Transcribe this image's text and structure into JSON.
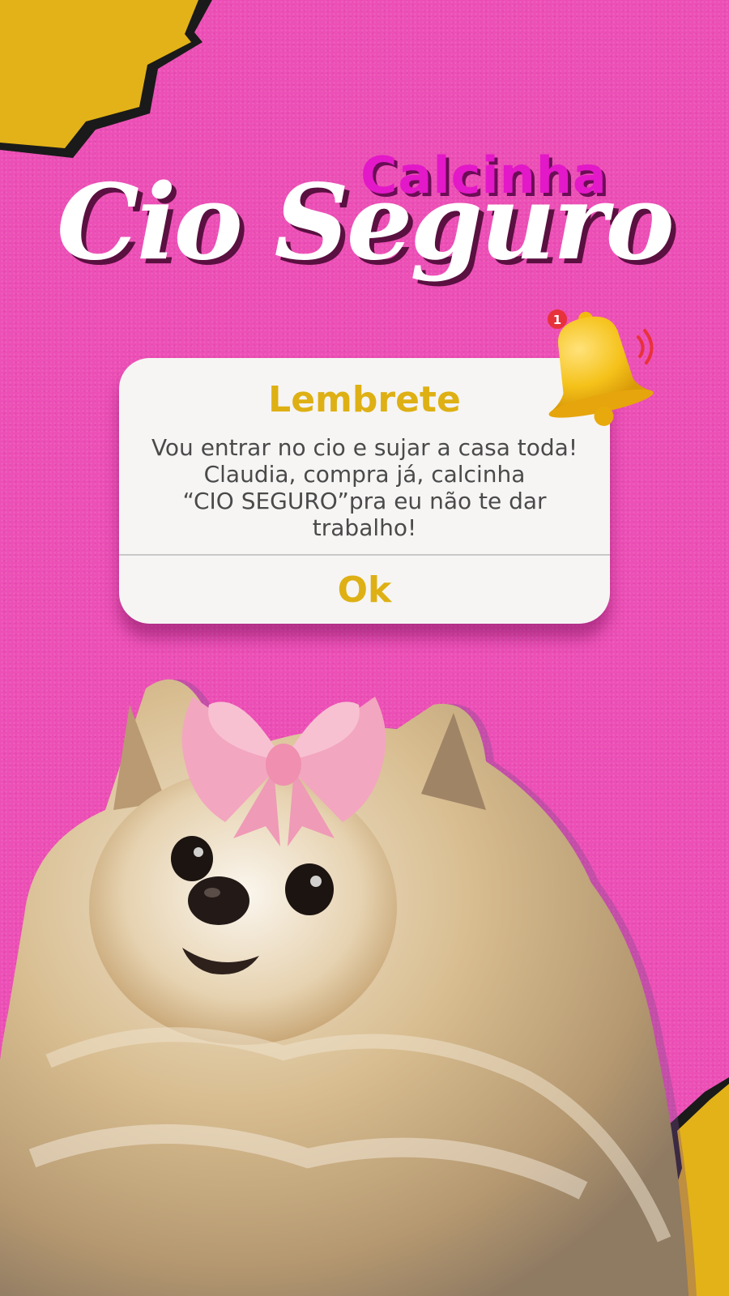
{
  "poster": {
    "subtitle": "Calcinha",
    "title": "Cio Seguro"
  },
  "dialog": {
    "title": "Lembrete",
    "body_lines": [
      "Vou entrar no cio e sujar a casa toda!",
      "Claudia, compra já, calcinha",
      "“CIO SEGURO”pra eu não te dar",
      "trabalho!"
    ],
    "ok_label": "Ok"
  },
  "bell": {
    "badge": "1",
    "icon": "bell-icon"
  },
  "colors": {
    "background": "#ec4fb6",
    "accent_yellow": "#deb014",
    "subtitle": "#e318c8",
    "title": "#ffffff"
  }
}
